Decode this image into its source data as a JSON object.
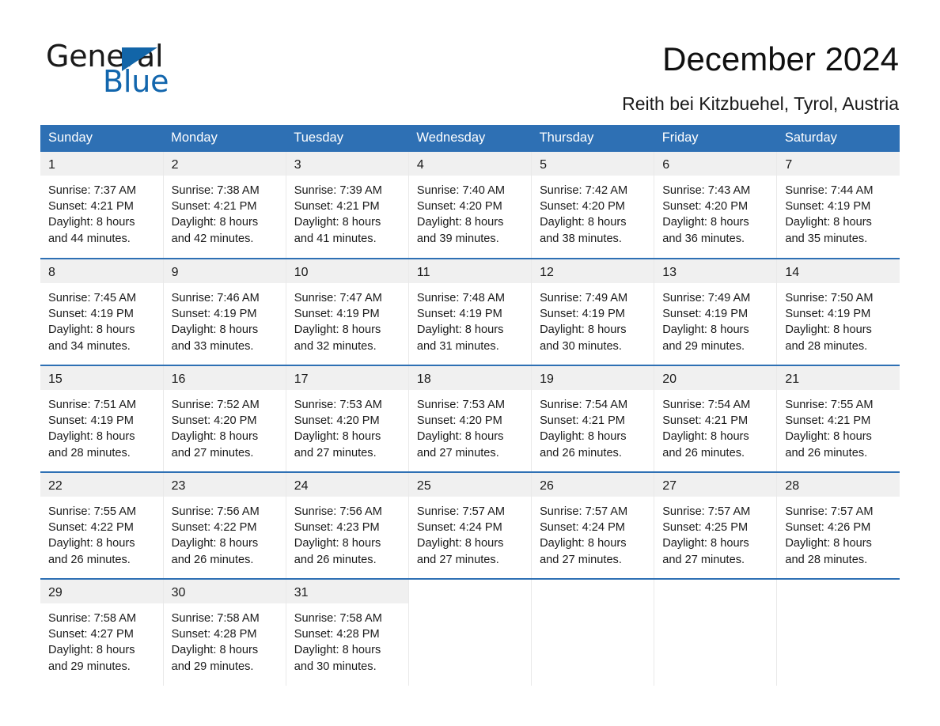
{
  "brand": {
    "name_part1": "General",
    "name_part2": "Blue",
    "triangle_color": "#1265a8",
    "blue_text_color": "#1266ad"
  },
  "header": {
    "title": "December 2024",
    "subtitle": "Reith bei Kitzbuehel, Tyrol, Austria"
  },
  "colors": {
    "header_blue": "#2e70b4",
    "daynum_band": "#f0f0f0",
    "row_rule": "#2e70b4"
  },
  "weekdays": [
    "Sunday",
    "Monday",
    "Tuesday",
    "Wednesday",
    "Thursday",
    "Friday",
    "Saturday"
  ],
  "weeks": [
    [
      {
        "day": "1",
        "sunrise": "Sunrise: 7:37 AM",
        "sunset": "Sunset: 4:21 PM",
        "daylight1": "Daylight: 8 hours",
        "daylight2": "and 44 minutes."
      },
      {
        "day": "2",
        "sunrise": "Sunrise: 7:38 AM",
        "sunset": "Sunset: 4:21 PM",
        "daylight1": "Daylight: 8 hours",
        "daylight2": "and 42 minutes."
      },
      {
        "day": "3",
        "sunrise": "Sunrise: 7:39 AM",
        "sunset": "Sunset: 4:21 PM",
        "daylight1": "Daylight: 8 hours",
        "daylight2": "and 41 minutes."
      },
      {
        "day": "4",
        "sunrise": "Sunrise: 7:40 AM",
        "sunset": "Sunset: 4:20 PM",
        "daylight1": "Daylight: 8 hours",
        "daylight2": "and 39 minutes."
      },
      {
        "day": "5",
        "sunrise": "Sunrise: 7:42 AM",
        "sunset": "Sunset: 4:20 PM",
        "daylight1": "Daylight: 8 hours",
        "daylight2": "and 38 minutes."
      },
      {
        "day": "6",
        "sunrise": "Sunrise: 7:43 AM",
        "sunset": "Sunset: 4:20 PM",
        "daylight1": "Daylight: 8 hours",
        "daylight2": "and 36 minutes."
      },
      {
        "day": "7",
        "sunrise": "Sunrise: 7:44 AM",
        "sunset": "Sunset: 4:19 PM",
        "daylight1": "Daylight: 8 hours",
        "daylight2": "and 35 minutes."
      }
    ],
    [
      {
        "day": "8",
        "sunrise": "Sunrise: 7:45 AM",
        "sunset": "Sunset: 4:19 PM",
        "daylight1": "Daylight: 8 hours",
        "daylight2": "and 34 minutes."
      },
      {
        "day": "9",
        "sunrise": "Sunrise: 7:46 AM",
        "sunset": "Sunset: 4:19 PM",
        "daylight1": "Daylight: 8 hours",
        "daylight2": "and 33 minutes."
      },
      {
        "day": "10",
        "sunrise": "Sunrise: 7:47 AM",
        "sunset": "Sunset: 4:19 PM",
        "daylight1": "Daylight: 8 hours",
        "daylight2": "and 32 minutes."
      },
      {
        "day": "11",
        "sunrise": "Sunrise: 7:48 AM",
        "sunset": "Sunset: 4:19 PM",
        "daylight1": "Daylight: 8 hours",
        "daylight2": "and 31 minutes."
      },
      {
        "day": "12",
        "sunrise": "Sunrise: 7:49 AM",
        "sunset": "Sunset: 4:19 PM",
        "daylight1": "Daylight: 8 hours",
        "daylight2": "and 30 minutes."
      },
      {
        "day": "13",
        "sunrise": "Sunrise: 7:49 AM",
        "sunset": "Sunset: 4:19 PM",
        "daylight1": "Daylight: 8 hours",
        "daylight2": "and 29 minutes."
      },
      {
        "day": "14",
        "sunrise": "Sunrise: 7:50 AM",
        "sunset": "Sunset: 4:19 PM",
        "daylight1": "Daylight: 8 hours",
        "daylight2": "and 28 minutes."
      }
    ],
    [
      {
        "day": "15",
        "sunrise": "Sunrise: 7:51 AM",
        "sunset": "Sunset: 4:19 PM",
        "daylight1": "Daylight: 8 hours",
        "daylight2": "and 28 minutes."
      },
      {
        "day": "16",
        "sunrise": "Sunrise: 7:52 AM",
        "sunset": "Sunset: 4:20 PM",
        "daylight1": "Daylight: 8 hours",
        "daylight2": "and 27 minutes."
      },
      {
        "day": "17",
        "sunrise": "Sunrise: 7:53 AM",
        "sunset": "Sunset: 4:20 PM",
        "daylight1": "Daylight: 8 hours",
        "daylight2": "and 27 minutes."
      },
      {
        "day": "18",
        "sunrise": "Sunrise: 7:53 AM",
        "sunset": "Sunset: 4:20 PM",
        "daylight1": "Daylight: 8 hours",
        "daylight2": "and 27 minutes."
      },
      {
        "day": "19",
        "sunrise": "Sunrise: 7:54 AM",
        "sunset": "Sunset: 4:21 PM",
        "daylight1": "Daylight: 8 hours",
        "daylight2": "and 26 minutes."
      },
      {
        "day": "20",
        "sunrise": "Sunrise: 7:54 AM",
        "sunset": "Sunset: 4:21 PM",
        "daylight1": "Daylight: 8 hours",
        "daylight2": "and 26 minutes."
      },
      {
        "day": "21",
        "sunrise": "Sunrise: 7:55 AM",
        "sunset": "Sunset: 4:21 PM",
        "daylight1": "Daylight: 8 hours",
        "daylight2": "and 26 minutes."
      }
    ],
    [
      {
        "day": "22",
        "sunrise": "Sunrise: 7:55 AM",
        "sunset": "Sunset: 4:22 PM",
        "daylight1": "Daylight: 8 hours",
        "daylight2": "and 26 minutes."
      },
      {
        "day": "23",
        "sunrise": "Sunrise: 7:56 AM",
        "sunset": "Sunset: 4:22 PM",
        "daylight1": "Daylight: 8 hours",
        "daylight2": "and 26 minutes."
      },
      {
        "day": "24",
        "sunrise": "Sunrise: 7:56 AM",
        "sunset": "Sunset: 4:23 PM",
        "daylight1": "Daylight: 8 hours",
        "daylight2": "and 26 minutes."
      },
      {
        "day": "25",
        "sunrise": "Sunrise: 7:57 AM",
        "sunset": "Sunset: 4:24 PM",
        "daylight1": "Daylight: 8 hours",
        "daylight2": "and 27 minutes."
      },
      {
        "day": "26",
        "sunrise": "Sunrise: 7:57 AM",
        "sunset": "Sunset: 4:24 PM",
        "daylight1": "Daylight: 8 hours",
        "daylight2": "and 27 minutes."
      },
      {
        "day": "27",
        "sunrise": "Sunrise: 7:57 AM",
        "sunset": "Sunset: 4:25 PM",
        "daylight1": "Daylight: 8 hours",
        "daylight2": "and 27 minutes."
      },
      {
        "day": "28",
        "sunrise": "Sunrise: 7:57 AM",
        "sunset": "Sunset: 4:26 PM",
        "daylight1": "Daylight: 8 hours",
        "daylight2": "and 28 minutes."
      }
    ],
    [
      {
        "day": "29",
        "sunrise": "Sunrise: 7:58 AM",
        "sunset": "Sunset: 4:27 PM",
        "daylight1": "Daylight: 8 hours",
        "daylight2": "and 29 minutes."
      },
      {
        "day": "30",
        "sunrise": "Sunrise: 7:58 AM",
        "sunset": "Sunset: 4:28 PM",
        "daylight1": "Daylight: 8 hours",
        "daylight2": "and 29 minutes."
      },
      {
        "day": "31",
        "sunrise": "Sunrise: 7:58 AM",
        "sunset": "Sunset: 4:28 PM",
        "daylight1": "Daylight: 8 hours",
        "daylight2": "and 30 minutes."
      },
      {
        "day": "",
        "sunrise": "",
        "sunset": "",
        "daylight1": "",
        "daylight2": ""
      },
      {
        "day": "",
        "sunrise": "",
        "sunset": "",
        "daylight1": "",
        "daylight2": ""
      },
      {
        "day": "",
        "sunrise": "",
        "sunset": "",
        "daylight1": "",
        "daylight2": ""
      },
      {
        "day": "",
        "sunrise": "",
        "sunset": "",
        "daylight1": "",
        "daylight2": ""
      }
    ]
  ]
}
